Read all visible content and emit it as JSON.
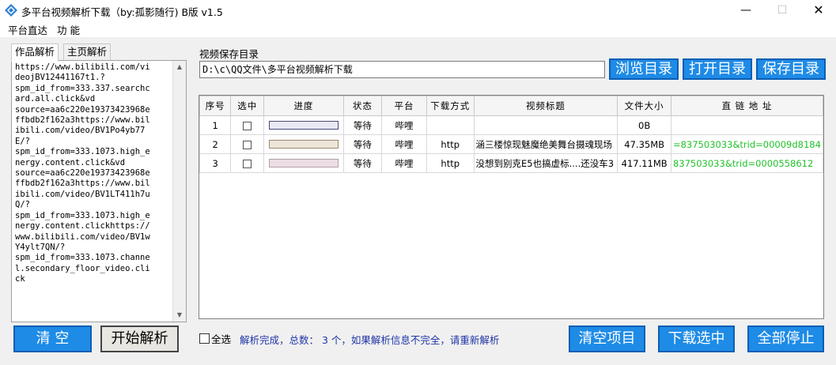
{
  "window": {
    "title": "多平台视频解析下载（by:孤影随行) B版 v1.5",
    "minimize": "—",
    "maximize": "☐",
    "close": "✕"
  },
  "menu": [
    "平台直达",
    "功 能"
  ],
  "tabs": [
    "作品解析",
    "主页解析"
  ],
  "url_text": "https://www.bilibili.com/vi\ndeojBV12441167t1.?\nspm_id_from=333.337.searchc\nard.all.click&vd\nsource=aa6c220e19373423968e\nffbdb2f162a3https://www.bil\nibili.com/video/BV1Po4yb77\nE/?\nspm_id_from=333.1073.high_e\nnergy.content.click&vd\nsource=aa6c220e19373423968e\nffbdb2f162a3https://www.bil\nibili.com/video/BV1LT411h7u\nQ/?\nspm_id_from=333.1073.high_e\nnergy.content.clickhttps://\nwww.bilibili.com/video/BV1w\nY4ylt7QN/?\nspm_id_from=333.1073.channe\nl.secondary_floor_video.cli\nck",
  "left_buttons": {
    "clear": "清  空",
    "start": "开始解析"
  },
  "save_dir": {
    "label": "视频保存目录",
    "path": "D:\\c\\QQ文件\\多平台视频解析下载",
    "browse": "浏览目录",
    "open": "打开目录",
    "save": "保存目录"
  },
  "table": {
    "headers": [
      "序号",
      "选中",
      "进度",
      "状态",
      "平台",
      "下载方式",
      "视频标题",
      "文件大小",
      "直 链 地 址"
    ],
    "rows": [
      {
        "index": "1",
        "progress_color": "#e8e8f4",
        "progress_border": "#4a4a7a",
        "status": "等待",
        "platform": "哔哩",
        "method": "",
        "title": "",
        "size": "0B",
        "link": ""
      },
      {
        "index": "2",
        "progress_color": "#ede5d8",
        "progress_border": "#9a8a70",
        "status": "等待",
        "platform": "哔哩",
        "method": "http",
        "title": "涵三楼惊现魅魔绝美舞台摄魂现场",
        "size": "47.35MB",
        "link": "=837503033&trid=00009d8184"
      },
      {
        "index": "3",
        "progress_color": "#ecdde4",
        "progress_border": "#b0a0a8",
        "status": "等待",
        "platform": "哔哩",
        "method": "http",
        "title": "没想到别克E5也搞虚标....还没车3",
        "size": "417.11MB",
        "link": "837503033&trid=0000558612"
      }
    ]
  },
  "bottom": {
    "select_all": "全选",
    "status": "解析完成，总数：  3 个，如果解析信息不完全，请重新解析",
    "clear_items": "清空项目",
    "download_selected": "下载选中",
    "stop_all": "全部停止"
  },
  "colors": {
    "button_blue": "#1e8be6",
    "link_green": "#22c22a",
    "status_blue": "#1f35a8"
  }
}
